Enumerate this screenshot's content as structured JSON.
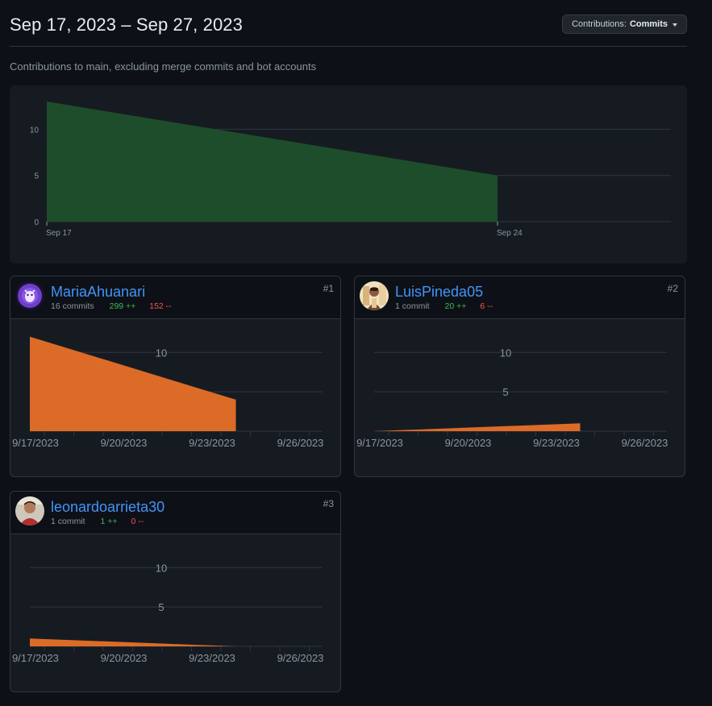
{
  "header": {
    "range_title": "Sep 17, 2023 – Sep 27, 2023",
    "contributions_label": "Contributions:",
    "contributions_value": "Commits"
  },
  "subtitle": "Contributions to main, excluding merge commits and bot accounts",
  "colors": {
    "overview_fill": "#1e4d2b",
    "contributor_fill": "#dd6b28",
    "link": "#4493f8",
    "additions": "#3fb950",
    "deletions": "#f85149"
  },
  "chart_data": [
    {
      "type": "area",
      "ylim": [
        0,
        13
      ],
      "y_ticks": [
        0,
        5,
        10
      ],
      "x_ticks": [
        "Sep 17",
        "Sep 24"
      ],
      "x": [
        "2023-09-17",
        "2023-09-24"
      ],
      "values": [
        13,
        5
      ],
      "grid": true
    },
    {
      "type": "area",
      "ylim": [
        0,
        13
      ],
      "y_ticks": [
        5,
        10
      ],
      "x_ticks": [
        "9/17/2023",
        "9/20/2023",
        "9/23/2023",
        "9/26/2023"
      ],
      "x": [
        "2023-09-17",
        "2023-09-24"
      ],
      "series": [
        {
          "values": [
            12,
            4
          ]
        }
      ]
    },
    {
      "type": "area",
      "ylim": [
        0,
        13
      ],
      "y_ticks": [
        5,
        10
      ],
      "x_ticks": [
        "9/17/2023",
        "9/20/2023",
        "9/23/2023",
        "9/26/2023"
      ],
      "x": [
        "2023-09-17",
        "2023-09-24"
      ],
      "series": [
        {
          "values": [
            0,
            1
          ]
        }
      ]
    },
    {
      "type": "area",
      "ylim": [
        0,
        13
      ],
      "y_ticks": [
        5,
        10
      ],
      "x_ticks": [
        "9/17/2023",
        "9/20/2023",
        "9/23/2023",
        "9/26/2023"
      ],
      "x": [
        "2023-09-17",
        "2023-09-24"
      ],
      "series": [
        {
          "values": [
            1,
            0
          ]
        }
      ]
    }
  ],
  "contributors": [
    {
      "rank": "#1",
      "username": "MariaAhuanari",
      "commits": "16 commits",
      "additions": "299 ++",
      "deletions": "152 --"
    },
    {
      "rank": "#2",
      "username": "LuisPineda05",
      "commits": "1 commit",
      "additions": "20 ++",
      "deletions": "6 --"
    },
    {
      "rank": "#3",
      "username": "leonardoarrieta30",
      "commits": "1 commit",
      "additions": "1 ++",
      "deletions": "0 --"
    }
  ]
}
